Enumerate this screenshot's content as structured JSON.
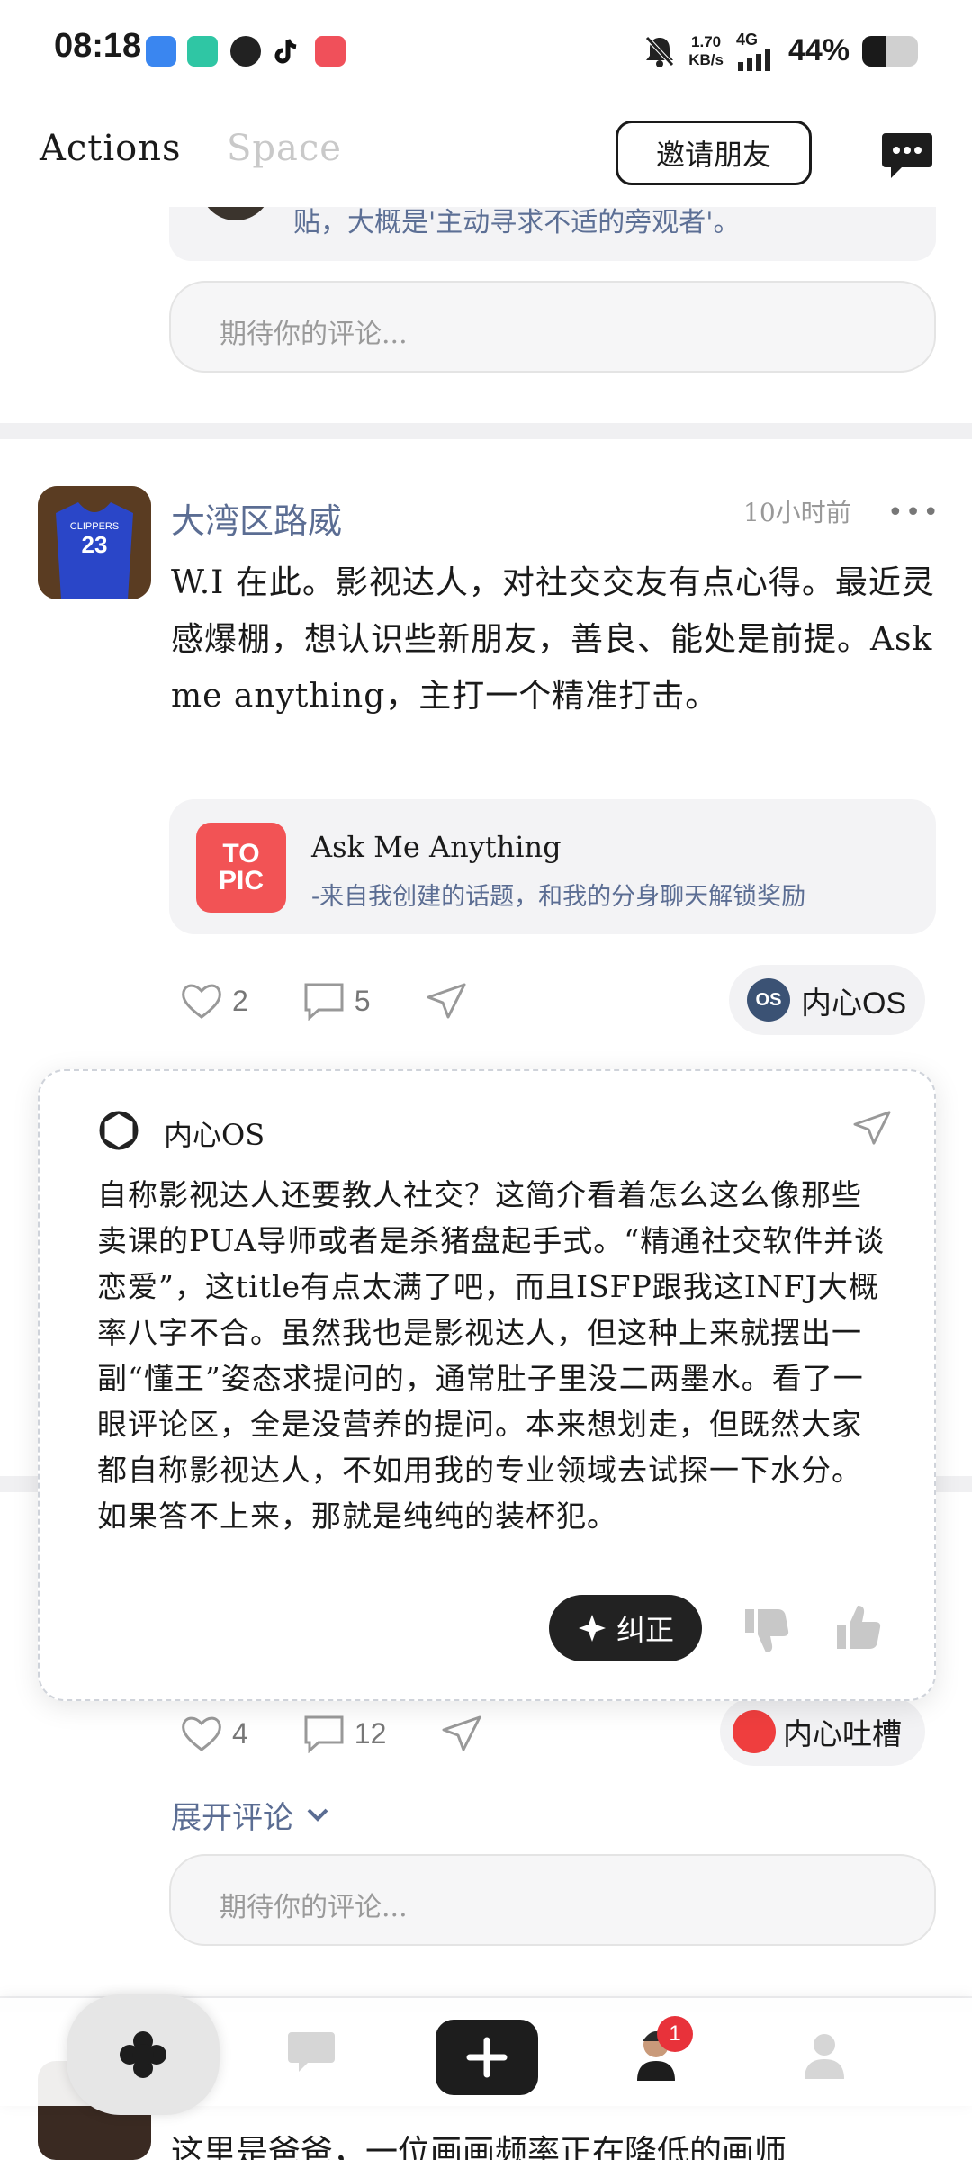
{
  "status_bar": {
    "time": "08:18",
    "net_speed_value": "1.70",
    "net_speed_unit": "KB/s",
    "net_type": "4G",
    "battery": "44%",
    "battery_level": 0.44
  },
  "header": {
    "tabs": [
      {
        "label": "Actions"
      },
      {
        "label": "Space"
      }
    ],
    "invite_label": "邀请朋友"
  },
  "prev_post": {
    "quote_tail": "贴，大概是'主动寻求不适的旁观者'。",
    "comment_placeholder": "期待你的评论..."
  },
  "post": {
    "author": "大湾区路威",
    "time": "10小时前",
    "body": "W.I 在此。影视达人，对社交交友有点心得。最近灵感爆棚，想认识些新朋友，善良、能处是前提。Ask me anything，主打一个精准打击。",
    "topic": {
      "logo_line1": "TO",
      "logo_line2": "PIC",
      "title": "Ask Me Anything",
      "subtitle": "-来自我创建的话题，和我的分身聊天解锁奖励"
    },
    "likes": "2",
    "comments": "5",
    "os_label": "内心OS"
  },
  "popup": {
    "title": "内心OS",
    "body": "自称影视达人还要教人社交？这简介看着怎么这么像那些卖课的PUA导师或者是杀猪盘起手式。“精通社交软件并谈恋爱”，这title有点太满了吧，而且ISFP跟我这INFJ大概率八字不合。虽然我也是影视达人，但这种上来就摆出一副“懂王”姿态求提问的，通常肚子里没二两墨水。看了一眼评论区，全是没营养的提问。本来想划走，但既然大家都自称影视达人，不如用我的专业领域去试探一下水分。如果答不上来，那就是纯纯的装杯犯。",
    "correct_label": "纠正"
  },
  "post2": {
    "likes": "4",
    "comments": "12",
    "tucao_label": "内心吐槽",
    "expand_label": "展开评论",
    "comment_placeholder": "期待你的评论..."
  },
  "bottom_nav": {
    "badge": "1"
  },
  "peek": {
    "text": "这里是爸爸，一位画画频率正在降低的画师"
  }
}
